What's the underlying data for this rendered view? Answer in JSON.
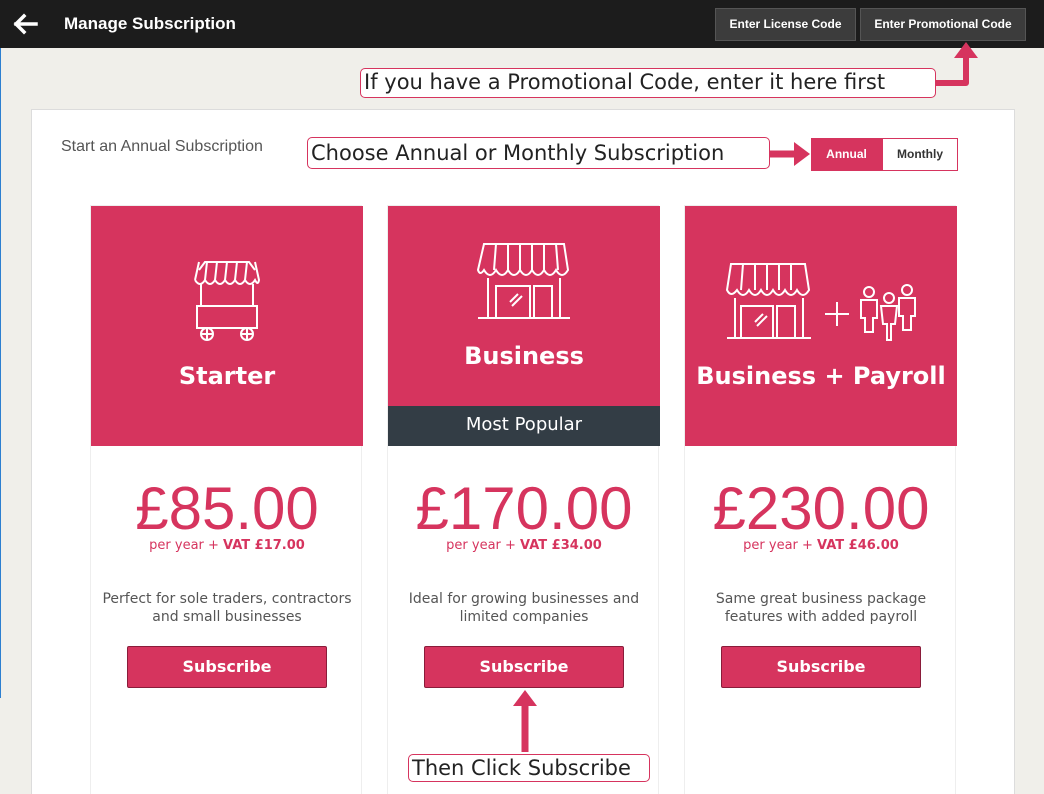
{
  "header": {
    "title": "Manage Subscription",
    "back_icon": "arrow-left-icon",
    "license_button": "Enter License Code",
    "promo_button": "Enter Promotional Code"
  },
  "annotations": {
    "promo_hint": "If you have a Promotional Code, enter it here first",
    "choose_hint": "Choose Annual or Monthly Subscription",
    "subscribe_hint": "Then Click Subscribe"
  },
  "panel": {
    "label": "Start an Annual Subscription",
    "toggle": {
      "annual": "Annual",
      "monthly": "Monthly",
      "selected": "Annual"
    }
  },
  "plans": [
    {
      "name": "Starter",
      "icon": "market-stall-icon",
      "price": "£85.00",
      "per": "per year + ",
      "vat": "VAT £17.00",
      "description": "Perfect for sole traders, contractors and small businesses",
      "button": "Subscribe"
    },
    {
      "name": "Business",
      "icon": "shop-icon",
      "badge": "Most Popular",
      "price": "£170.00",
      "per": "per year + ",
      "vat": "VAT £34.00",
      "description": "Ideal for growing businesses and limited companies",
      "button": "Subscribe"
    },
    {
      "name": "Business + Payroll",
      "icon": "shop-plus-people-icon",
      "price": "£230.00",
      "per": "per year + ",
      "vat": "VAT £46.00",
      "description": "Same great business package features with added payroll",
      "button": "Subscribe"
    }
  ],
  "colors": {
    "accent": "#d6345e",
    "topbar": "#1c1c1c",
    "badge": "#333d45",
    "background": "#f0efea"
  }
}
